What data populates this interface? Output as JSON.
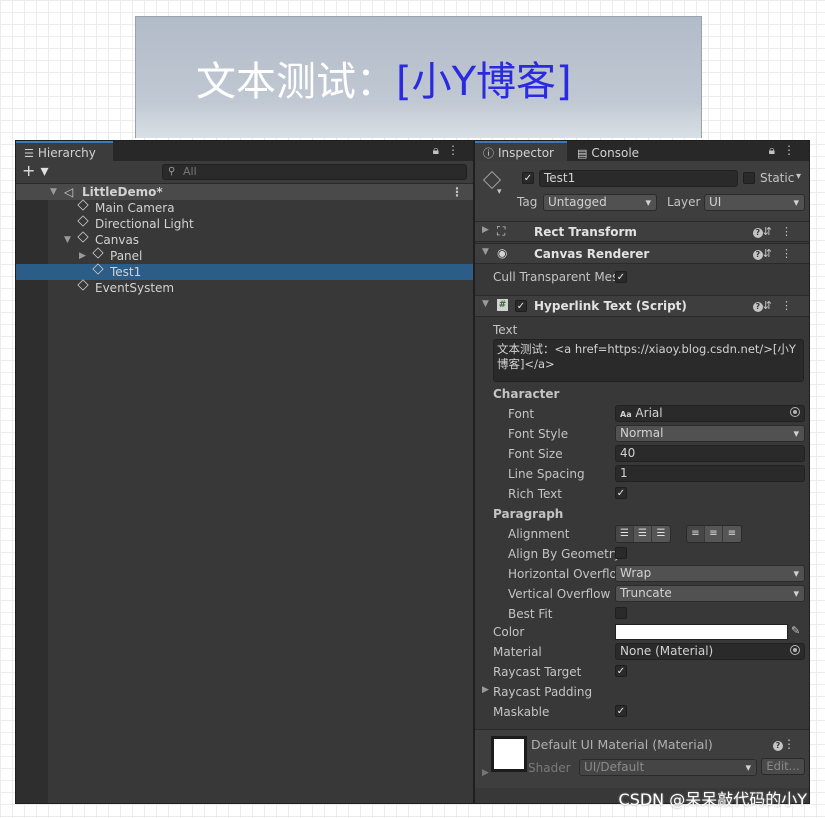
{
  "game_view": {
    "prefix_text": "文本测试：",
    "link_text": "[小Y博客]"
  },
  "hierarchy": {
    "tab_label": "Hierarchy",
    "add_label": "+ ▾",
    "search_placeholder": "All",
    "scene_name": "LittleDemo*",
    "items": [
      {
        "label": "Main Camera"
      },
      {
        "label": "Directional Light"
      },
      {
        "label": "Canvas"
      },
      {
        "label": "Panel"
      },
      {
        "label": "Test1"
      },
      {
        "label": "EventSystem"
      }
    ]
  },
  "inspector": {
    "tabs": [
      "Inspector",
      "Console"
    ],
    "object_name": "Test1",
    "static_label": "Static",
    "tag_label": "Tag",
    "tag_value": "Untagged",
    "layer_label": "Layer",
    "layer_value": "UI",
    "components": {
      "rect_transform": "Rect Transform",
      "canvas_renderer": "Canvas Renderer",
      "hyperlink_text": "Hyperlink Text (Script)"
    },
    "cull_label": "Cull Transparent Mes",
    "text_label": "Text",
    "text_value": "文本测试：<a href=https://xiaoy.blog.csdn.net/>[小Y博客]</a>",
    "character_label": "Character",
    "font_label": "Font",
    "font_value": "Arial",
    "font_style_label": "Font Style",
    "font_style_value": "Normal",
    "font_size_label": "Font Size",
    "font_size_value": "40",
    "line_spacing_label": "Line Spacing",
    "line_spacing_value": "1",
    "rich_text_label": "Rich Text",
    "paragraph_label": "Paragraph",
    "alignment_label": "Alignment",
    "align_geometry_label": "Align By Geometry",
    "horizontal_overflow_label": "Horizontal Overflo",
    "horizontal_overflow_value": "Wrap",
    "vertical_overflow_label": "Vertical Overflow",
    "vertical_overflow_value": "Truncate",
    "best_fit_label": "Best Fit",
    "color_label": "Color",
    "color_value": "#ffffff",
    "material_label": "Material",
    "material_value": "None (Material)",
    "raycast_target_label": "Raycast Target",
    "raycast_padding_label": "Raycast Padding",
    "maskable_label": "Maskable",
    "default_material_label": "Default UI Material (Material)",
    "shader_label": "Shader",
    "shader_value": "UI/Default",
    "edit_label": "Edit..."
  },
  "watermark": "CSDN @呆呆敲代码的小Y",
  "colors": {
    "panel_bg": "#383838",
    "selected_row": "#2c5d87",
    "tab_accent": "#3a79bb",
    "link_text": "#2a2ae0"
  }
}
